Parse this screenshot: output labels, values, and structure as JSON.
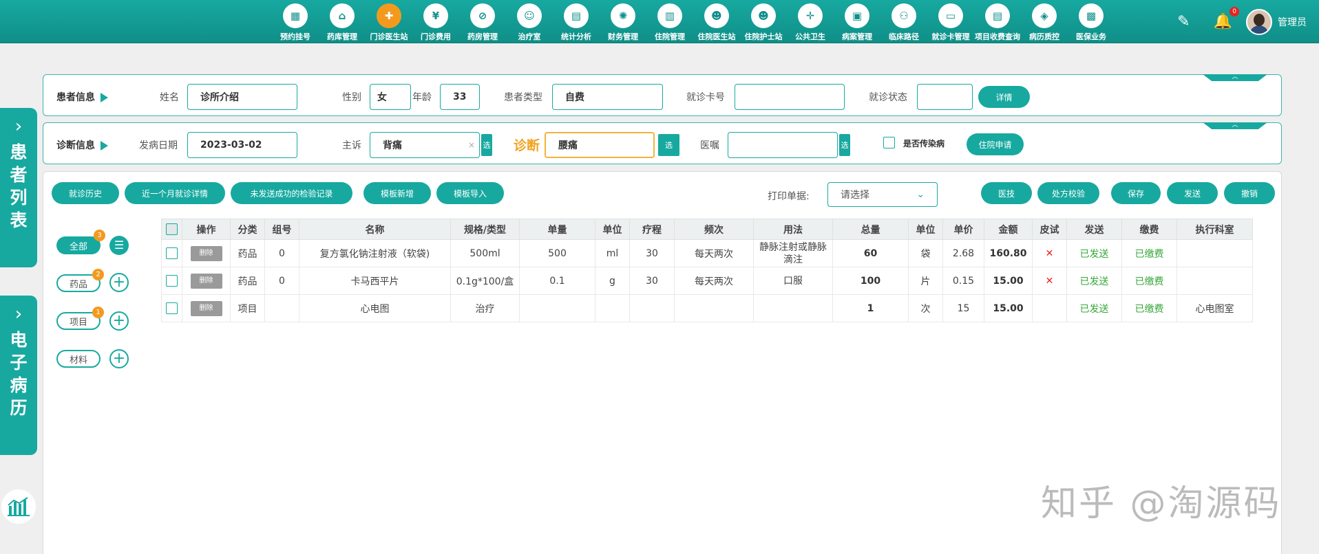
{
  "nav": {
    "items": [
      {
        "label": "预约挂号",
        "glyph": "▦"
      },
      {
        "label": "药库管理",
        "glyph": "⌂"
      },
      {
        "label": "门诊医生站",
        "glyph": "✚"
      },
      {
        "label": "门诊费用",
        "glyph": "¥"
      },
      {
        "label": "药房管理",
        "glyph": "⊘"
      },
      {
        "label": "治疗室",
        "glyph": "☺"
      },
      {
        "label": "统计分析",
        "glyph": "▤"
      },
      {
        "label": "财务管理",
        "glyph": "✺"
      },
      {
        "label": "住院管理",
        "glyph": "▥"
      },
      {
        "label": "住院医生站",
        "glyph": "☻"
      },
      {
        "label": "住院护士站",
        "glyph": "☻"
      },
      {
        "label": "公共卫生",
        "glyph": "✛"
      },
      {
        "label": "病案管理",
        "glyph": "▣"
      },
      {
        "label": "临床路径",
        "glyph": "⚇"
      },
      {
        "label": "就诊卡管理",
        "glyph": "▭"
      },
      {
        "label": "项目收费查询",
        "glyph": "▤"
      },
      {
        "label": "病历质控",
        "glyph": "◈"
      },
      {
        "label": "医保业务",
        "glyph": "▩"
      }
    ],
    "active_index": 2,
    "notifications": "0",
    "user": "管理员"
  },
  "side": {
    "patients_tab": "患者列表",
    "emr_tab": "电子病历"
  },
  "patient": {
    "section": "患者信息",
    "name_label": "姓名",
    "name": "诊所介绍",
    "gender_label": "性别",
    "gender": "女",
    "age_label": "年龄",
    "age": "33",
    "type_label": "患者类型",
    "type": "自费",
    "card_label": "就诊卡号",
    "card": "",
    "status_label": "就诊状态",
    "status": "",
    "details_btn": "详情"
  },
  "diagnosis": {
    "section": "诊断信息",
    "onset_label": "发病日期",
    "onset": "2023-03-02",
    "complaint_label": "主诉",
    "complaint": "背痛",
    "select_label": "选",
    "diag_label": "诊断",
    "diag": "腰痛",
    "advice_label": "医嘱",
    "advice": "",
    "infectious_label": "是否传染病",
    "admit_btn": "住院申请"
  },
  "toolbar": {
    "history": "就诊历史",
    "month_detail": "近一个月就诊详情",
    "unsent": "未发送成功的检验记录",
    "tpl_new": "模板新增",
    "tpl_import": "模板导入",
    "print_label": "打印单据:",
    "print_placeholder": "请选择",
    "tech": "医技",
    "rx_check": "处方校验",
    "save": "保存",
    "send": "发送",
    "revoke": "撤销"
  },
  "categories": [
    {
      "label": "全部",
      "count": "3"
    },
    {
      "label": "药品",
      "count": "2"
    },
    {
      "label": "项目",
      "count": "1"
    },
    {
      "label": "材料",
      "count": ""
    }
  ],
  "table": {
    "headers": [
      "操作",
      "分类",
      "组号",
      "名称",
      "规格/类型",
      "单量",
      "单位",
      "疗程",
      "频次",
      "用法",
      "总量",
      "单位",
      "单价",
      "金额",
      "皮试",
      "发送",
      "缴费",
      "执行科室"
    ],
    "delete_label": "删除",
    "rows": [
      {
        "cat": "药品",
        "group": "0",
        "name": "复方氯化钠注射液（软袋)",
        "spec": "500ml",
        "dose": "500",
        "unit": "ml",
        "course": "30",
        "freq": "每天两次",
        "usage": "静脉注射或静脉滴注",
        "total": "60",
        "tunit": "袋",
        "price": "2.68",
        "amount": "160.80",
        "skin": "✕",
        "sent": "已发送",
        "paid": "已缴费",
        "dept": ""
      },
      {
        "cat": "药品",
        "group": "0",
        "name": "卡马西平片",
        "spec": "0.1g*100/盒",
        "dose": "0.1",
        "unit": "g",
        "course": "30",
        "freq": "每天两次",
        "usage": "口服",
        "total": "100",
        "tunit": "片",
        "price": "0.15",
        "amount": "15.00",
        "skin": "✕",
        "sent": "已发送",
        "paid": "已缴费",
        "dept": ""
      },
      {
        "cat": "项目",
        "group": "",
        "name": "心电图",
        "spec": "治疗",
        "dose": "",
        "unit": "",
        "course": "",
        "freq": "",
        "usage": "",
        "total": "1",
        "tunit": "次",
        "price": "15",
        "amount": "15.00",
        "skin": "",
        "sent": "已发送",
        "paid": "已缴费",
        "dept": "心电图室"
      }
    ]
  },
  "watermark": "知乎 @淘源码"
}
